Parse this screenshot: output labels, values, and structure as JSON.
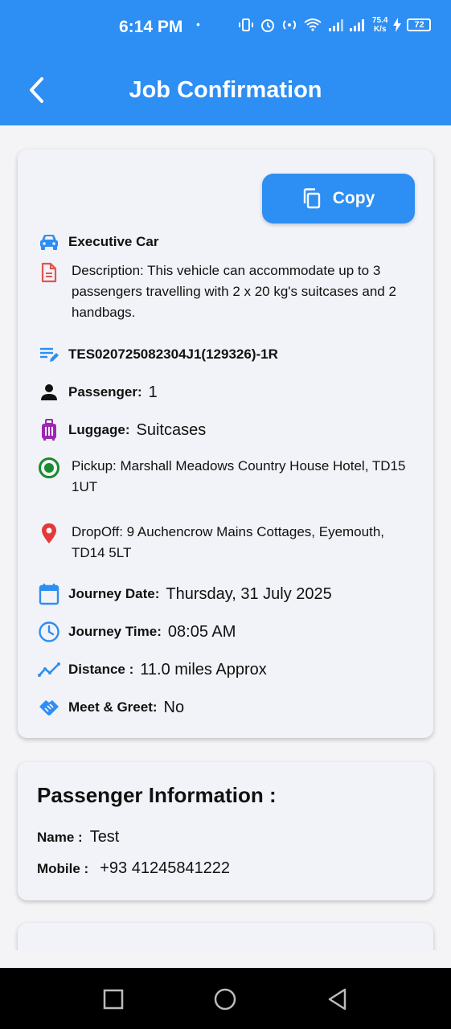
{
  "status_bar": {
    "time": "6:14 PM",
    "dot": "•",
    "speed_top": "75.4",
    "speed_bottom": "K/s",
    "battery": "72"
  },
  "app_bar": {
    "title": "Job Confirmation",
    "back_icon": "chevron-left-icon"
  },
  "job_card": {
    "copy_label": "Copy",
    "vehicle": "Executive Car",
    "description": "Description: This vehicle can accommodate up to 3 passengers travelling with 2 x 20 kg's suitcases and 2 handbags.",
    "reference": "TES020725082304J1(129326)-1R",
    "passenger_label": "Passenger:",
    "passenger_value": "1",
    "luggage_label": "Luggage:",
    "luggage_value": "Suitcases",
    "pickup": "Pickup: Marshall Meadows Country House Hotel, TD15 1UT",
    "dropoff": "DropOff: 9 Auchencrow Mains Cottages, Eyemouth, TD14 5LT",
    "journey_date_label": "Journey Date:",
    "journey_date_value": "Thursday, 31 July 2025",
    "journey_time_label": "Journey Time:",
    "journey_time_value": "08:05 AM",
    "distance_label": "Distance :",
    "distance_value": "11.0 miles Approx",
    "meet_greet_label": "Meet & Greet:",
    "meet_greet_value": "No"
  },
  "passenger_card": {
    "title": "Passenger Information :",
    "name_label": "Name :",
    "name_value": "Test",
    "mobile_label": "Mobile :",
    "mobile_value": "+93 41245841222"
  },
  "colors": {
    "primary": "#2d8ef3",
    "pickup_green": "#1a8a2e",
    "dropoff_red": "#e53935",
    "luggage_purple": "#9c27b0",
    "description_red": "#e05550"
  }
}
